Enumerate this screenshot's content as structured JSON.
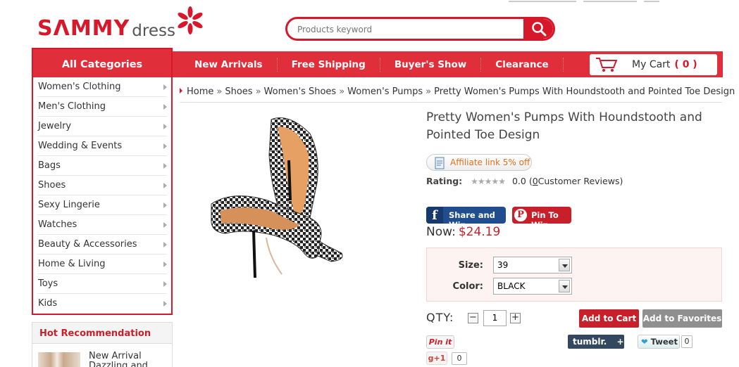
{
  "logo": {
    "brand": "SΛMMY",
    "suffix": "dress"
  },
  "search": {
    "placeholder": "Products keyword"
  },
  "nav": {
    "items": [
      {
        "label": "New Arrivals"
      },
      {
        "label": "Free Shipping"
      },
      {
        "label": "Buyer's Show"
      },
      {
        "label": "Clearance"
      }
    ],
    "cart_label": "My Cart",
    "cart_count": "( 0 )"
  },
  "categories": {
    "title": "All Categories",
    "items": [
      {
        "label": "Women's Clothing"
      },
      {
        "label": "Men's Clothing"
      },
      {
        "label": "Jewelry"
      },
      {
        "label": "Wedding & Events"
      },
      {
        "label": "Bags"
      },
      {
        "label": "Shoes"
      },
      {
        "label": "Sexy Lingerie"
      },
      {
        "label": "Watches"
      },
      {
        "label": "Beauty & Accessories"
      },
      {
        "label": "Home & Living"
      },
      {
        "label": "Toys"
      },
      {
        "label": "Kids"
      }
    ]
  },
  "hot": {
    "title": "Hot Recommendation",
    "item_text": "New Arrival Dazzling and"
  },
  "breadcrumb": {
    "items": [
      "Home",
      "Shoes",
      "Women's Shoes",
      "Women's Pumps",
      "Pretty Women's Pumps With Houndstooth and Pointed Toe Design"
    ],
    "separator": "»"
  },
  "product": {
    "title": "Pretty Women's Pumps With Houndstooth and Pointed Toe Design",
    "affiliate": "Affiliate link 5% off",
    "rating_label": "Rating:",
    "stars": "★★★★★",
    "rating_value": "0.0",
    "reviews_open": "(",
    "reviews_count": "0",
    "reviews_text": "Customer Reviews)",
    "share_facebook": "Share and Win",
    "share_pinterest": "Pin To Win",
    "price_label": "Now:",
    "price": "$24.19",
    "size_label": "Size:",
    "size_value": "39",
    "color_label": "Color:",
    "color_value": "BLACK",
    "qty_label": "QTY:",
    "qty_minus": "−",
    "qty_value": "1",
    "qty_plus": "+",
    "add_to_cart": "Add to Cart",
    "add_to_favorites": "Add to Favorites"
  },
  "social": {
    "pinit": "Pin it",
    "tumblr": "tumblr.",
    "tumblr_plus": "+",
    "tweet": "Tweet",
    "tweet_count": "0",
    "gplus": "g+1",
    "gplus_count": "0"
  },
  "colors": {
    "brand_red": "#d7182a",
    "nav_red": "#e02e3a",
    "price_red": "#c8202a",
    "fb_blue": "#1f4d8e"
  }
}
